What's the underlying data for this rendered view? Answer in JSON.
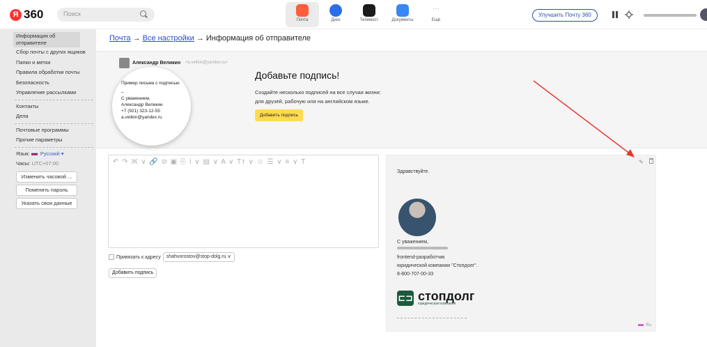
{
  "header": {
    "logo_badge": "Я",
    "logo_text": "360",
    "search_placeholder": "Поиск",
    "apps": [
      {
        "label": "Почта",
        "color": "#ff5e3a",
        "icon": "mail-icon",
        "active": true
      },
      {
        "label": "Диск",
        "color": "#2a6fe8",
        "icon": "disk-icon",
        "active": false
      },
      {
        "label": "Телемост",
        "color": "#1b1b1b",
        "icon": "telemost-icon",
        "active": false
      },
      {
        "label": "Документы",
        "color": "#3a86f5",
        "icon": "documents-icon",
        "active": false
      },
      {
        "label": "Ещё",
        "color": "#ffffff",
        "icon": "more-icon",
        "active": false
      }
    ],
    "upgrade_label": "Улучшить Почту 360"
  },
  "sidebar": {
    "active_item": "Информация об отправителе",
    "group1": [
      "Сбор почты с других ящиков",
      "Папки и метки",
      "Правила обработки почты",
      "Безопасность",
      "Управление рассылками"
    ],
    "group2": [
      "Контакты",
      "Дела"
    ],
    "group3": [
      "Почтовые программы",
      "Прочие параметры"
    ],
    "language_label": "Язык:",
    "language_value": "Русский",
    "timezone_label": "Часы:",
    "timezone_value": "UTC+07:00",
    "buttons": [
      "Изменить часовой ...",
      "Поменять пароль",
      "Указать свои данные"
    ]
  },
  "breadcrumb": {
    "mail": "Почта",
    "all_settings": "Все настройки",
    "current": "Информация об отправителе",
    "separator": "→"
  },
  "banner": {
    "example_from": "Александр Великин",
    "example_email": "<a.velikin@yandex.ru>",
    "example_lines": [
      "Пример письма с подписью",
      "–",
      "С уважением,",
      "Александр Великин",
      "+7 (921) 323-12-55",
      "a.velikin@yandex.ru"
    ],
    "title": "Добавьте подпись!",
    "desc_line1": "Создайте несколько подписей на все случаи жизни:",
    "desc_line2": "для друзей, рабочую или на английском языке.",
    "button": "Добавить подпись"
  },
  "editor": {
    "toolbar": "↶ ↷  Ж ∨ 🔗 ⊘  ▣ ⎘  I ∨ ▤ ∨  A ∨ Tт ∨  ☺  ☰ ∨  ≡ ∨  T",
    "bind_label": "Привязать к адресу",
    "address": "shahvorostov@stop-dolg.ru",
    "add_button": "Добавить подпись"
  },
  "preview": {
    "greeting": "Здравствуйте.",
    "regards": "С уважением,",
    "role": "frontend-разработчик",
    "company": "юридической компании \"Стопдолг\".",
    "phone": "8-800-707-00-33",
    "logo_name": "стопдолг",
    "logo_sub": "юридическая компания",
    "lang": "Ru"
  },
  "colors": {
    "accent_yellow": "#ffdb4d",
    "link_blue": "#2a4bd7",
    "arrow_red": "#e8372c"
  }
}
